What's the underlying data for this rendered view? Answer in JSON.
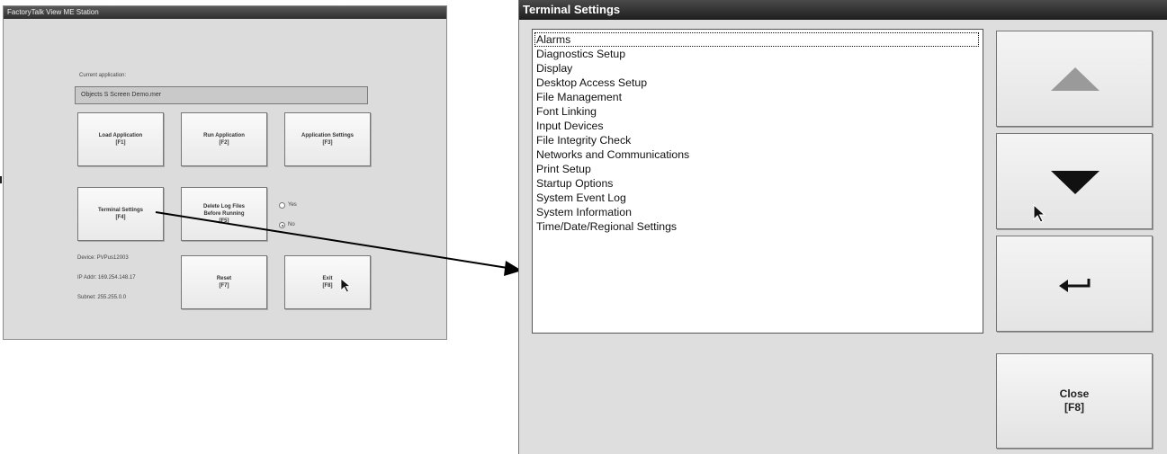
{
  "left_window": {
    "title": "FactoryTalk View ME Station",
    "current_app_label": "Current application:",
    "current_app_value": "Objects S Screen Demo.mer",
    "buttons": {
      "load": {
        "label": "Load Application",
        "key": "[F1]"
      },
      "run": {
        "label": "Run Application",
        "key": "[F2]"
      },
      "app_settings": {
        "label": "Application Settings",
        "key": "[F3]"
      },
      "terminal_settings": {
        "label": "Terminal Settings",
        "key": "[F4]"
      },
      "delete_log": {
        "label1": "Delete Log Files",
        "label2": "Before Running",
        "key": "[F5]"
      },
      "reset": {
        "label": "Reset",
        "key": "[F7]"
      },
      "exit": {
        "label": "Exit",
        "key": "[F8]"
      }
    },
    "radio_yes": "Yes",
    "radio_no": "No",
    "radio_selected": "No",
    "device": "Device: PVPus12003",
    "ip_addr": "IP Addr: 169.254.148.17",
    "subnet": "Subnet: 255.255.0.0"
  },
  "right_window": {
    "title": "Terminal Settings",
    "items": [
      "Alarms",
      "Diagnostics Setup",
      "Display",
      "Desktop Access Setup",
      "File Management",
      "Font Linking",
      "Input Devices",
      "File Integrity Check",
      "Networks and Communications",
      "Print Setup",
      "Startup Options",
      "System Event Log",
      "System Information",
      "Time/Date/Regional Settings"
    ],
    "selected_item": "Alarms",
    "close_label": "Close",
    "close_key": "[F8]"
  },
  "icons": {
    "up": "up-arrow-icon",
    "down": "down-arrow-icon",
    "enter": "enter-icon",
    "cursor": "mouse-pointer-icon"
  },
  "colors": {
    "title_bar": "#2e2e2e",
    "window_bg": "#dedede",
    "arrow_up": "#9a9a9a",
    "arrow_down": "#111111"
  }
}
